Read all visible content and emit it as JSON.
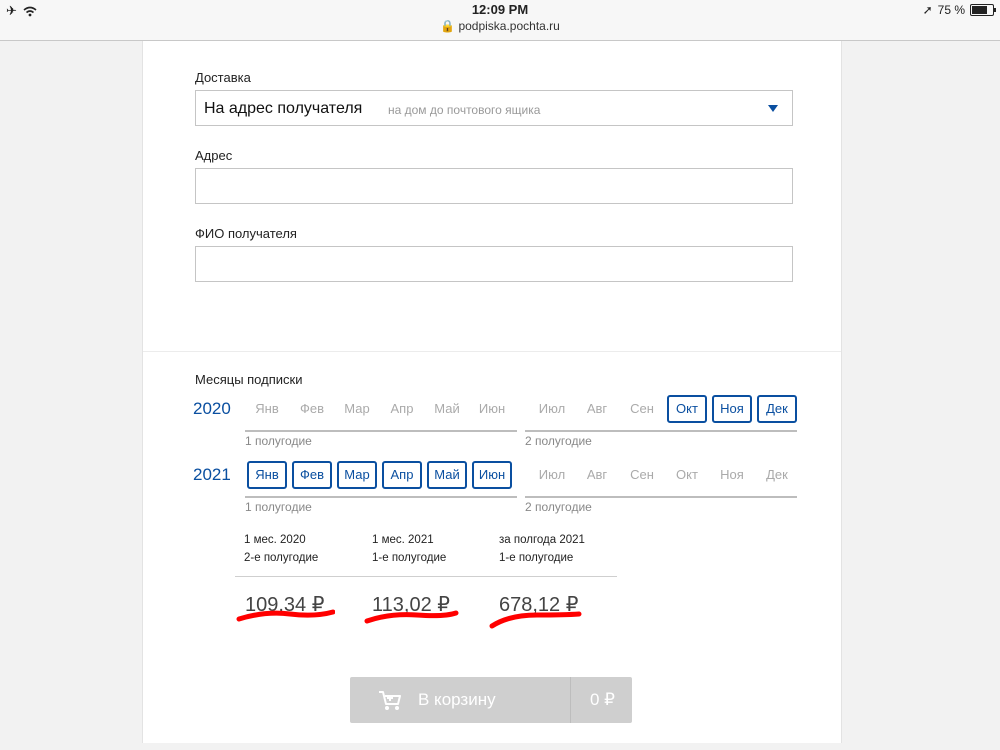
{
  "status": {
    "time": "12:09 PM",
    "url": "podpiska.pochta.ru",
    "battery": "75 %"
  },
  "delivery": {
    "label": "Доставка",
    "selected": "На адрес получателя",
    "selected_hint": "на дом до почтового ящика"
  },
  "address": {
    "label": "Адрес",
    "value": ""
  },
  "recipient": {
    "label": "ФИО получателя",
    "value": ""
  },
  "months": {
    "label": "Месяцы подписки",
    "half1_label": "1 полугодие",
    "half2_label": "2 полугодие",
    "years": [
      {
        "year": "2020",
        "months": [
          "Янв",
          "Фев",
          "Мар",
          "Апр",
          "Май",
          "Июн",
          "Июл",
          "Авг",
          "Сен",
          "Окт",
          "Ноя",
          "Дек"
        ],
        "selected": [
          false,
          false,
          false,
          false,
          false,
          false,
          false,
          false,
          false,
          true,
          true,
          true
        ]
      },
      {
        "year": "2021",
        "months": [
          "Янв",
          "Фев",
          "Мар",
          "Апр",
          "Май",
          "Июн",
          "Июл",
          "Авг",
          "Сен",
          "Окт",
          "Ноя",
          "Дек"
        ],
        "selected": [
          true,
          true,
          true,
          true,
          true,
          true,
          false,
          false,
          false,
          false,
          false,
          false
        ]
      }
    ]
  },
  "prices": [
    {
      "line1": "1 мес. 2020",
      "line2": "2-е полугодие",
      "amount": "109,34 ₽"
    },
    {
      "line1": "1 мес. 2021",
      "line2": "1-е полугодие",
      "amount": "113,02 ₽"
    },
    {
      "line1": "за полгода 2021",
      "line2": "1-е полугодие",
      "amount": "678,12 ₽"
    }
  ],
  "cart": {
    "label": "В корзину",
    "total": "0 ₽"
  },
  "colors": {
    "accent": "#0a4fa0",
    "scribble": "#ff0000"
  }
}
